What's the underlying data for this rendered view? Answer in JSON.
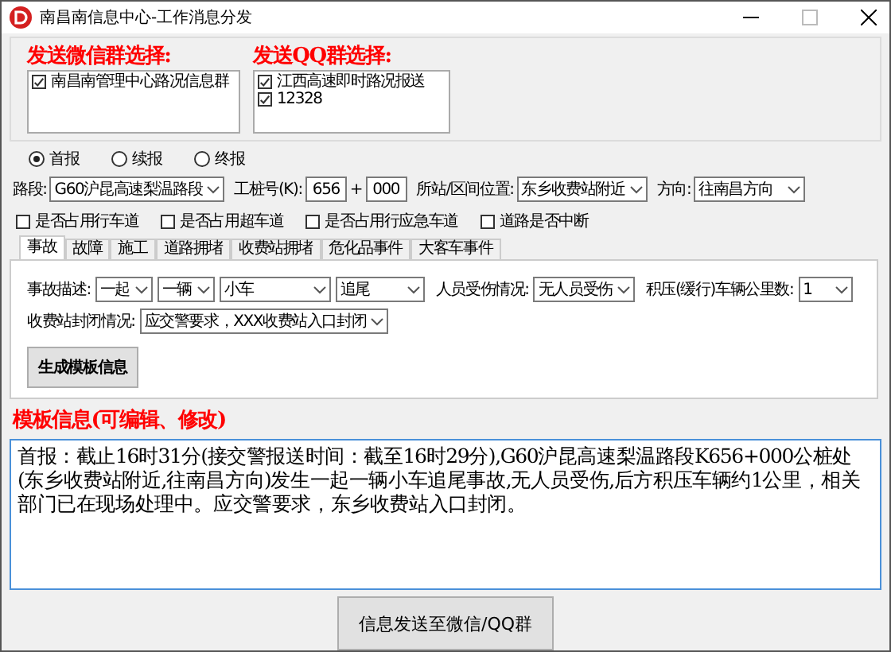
{
  "window": {
    "title": "南昌南信息中心-工作消息分发"
  },
  "wechat_groups": {
    "heading": "发送微信群选择:",
    "items": [
      {
        "label": "南昌南管理中心路况信息群",
        "checked": true
      }
    ]
  },
  "qq_groups": {
    "heading": "发送QQ群选择:",
    "items": [
      {
        "label": "江西高速即时路况报送",
        "checked": true
      },
      {
        "label": "12328",
        "checked": true
      }
    ]
  },
  "report_types": [
    {
      "label": "首报",
      "selected": true
    },
    {
      "label": "续报",
      "selected": false
    },
    {
      "label": "终报",
      "selected": false
    }
  ],
  "location": {
    "road_label": "路段:",
    "road": "G60沪昆高速梨温路段",
    "stake_label": "工桩号(K):",
    "stake_km": "656",
    "plus": "+",
    "stake_m": "000",
    "position_label": "所站/区间位置:",
    "position": "东乡收费站附近",
    "direction_label": "方向:",
    "direction": "往南昌方向"
  },
  "lane_flags": [
    {
      "label": "是否占用行车道",
      "checked": false
    },
    {
      "label": "是否占用超车道",
      "checked": false
    },
    {
      "label": "是否占用行应急车道",
      "checked": false
    },
    {
      "label": "道路是否中断",
      "checked": false
    }
  ],
  "tabs": [
    {
      "label": "事故",
      "selected": true
    },
    {
      "label": "故障",
      "selected": false
    },
    {
      "label": "施工",
      "selected": false
    },
    {
      "label": "道路拥堵",
      "selected": false
    },
    {
      "label": "收费站拥堵",
      "selected": false
    },
    {
      "label": "危化品事件",
      "selected": false
    },
    {
      "label": "大客车事件",
      "selected": false
    }
  ],
  "accident": {
    "description_label": "事故描述:",
    "description": [
      "一起",
      "一辆",
      "小车",
      "追尾"
    ],
    "injury_label": "人员受伤情况:",
    "injury": "无人员受伤",
    "queue_label": "积压(缓行)车辆公里数:",
    "queue": "1",
    "closure_label": "收费站封闭情况:",
    "closure": "应交警要求，XXX收费站入口封闭",
    "generate_button": "生成模板信息"
  },
  "template": {
    "heading": "模板信息(可编辑、修改)",
    "text": "首报：截止16时31分(接交警报送时间：截至16时29分),G60沪昆高速梨温路段K656+000公桩处(东乡收费站附近,往南昌方向)发生一起一辆小车追尾事故,无人员受伤,后方积压车辆约1公里，相关部门已在现场处理中。应交警要求，东乡收费站入口封闭。"
  },
  "send_button": "信息发送至微信/QQ群"
}
